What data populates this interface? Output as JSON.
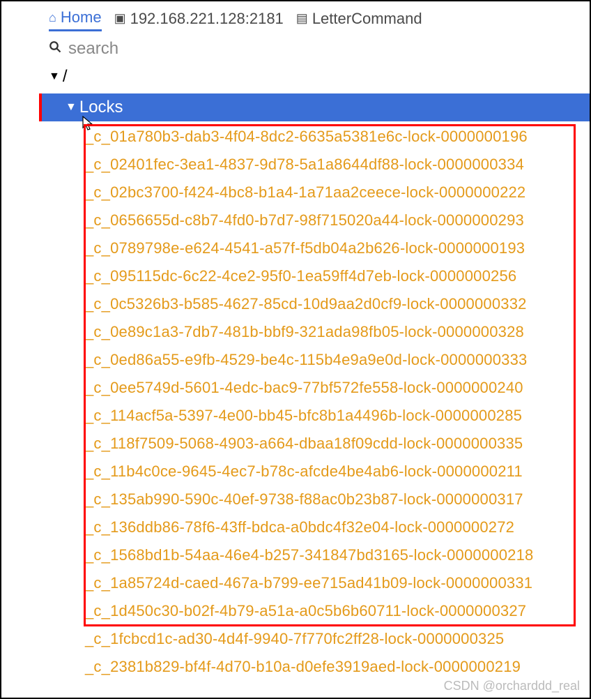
{
  "topbar": {
    "home_label": "Home",
    "server_label": "192.168.221.128:2181",
    "letter_label": "LetterCommand"
  },
  "search": {
    "placeholder": "search"
  },
  "tree": {
    "root_label": "/",
    "locks_label": "Locks",
    "nodes": [
      "_c_01a780b3-dab3-4f04-8dc2-6635a5381e6c-lock-0000000196",
      "_c_02401fec-3ea1-4837-9d78-5a1a8644df88-lock-0000000334",
      "_c_02bc3700-f424-4bc8-b1a4-1a71aa2ceece-lock-0000000222",
      "_c_0656655d-c8b7-4fd0-b7d7-98f715020a44-lock-0000000293",
      "_c_0789798e-e624-4541-a57f-f5db04a2b626-lock-0000000193",
      "_c_095115dc-6c22-4ce2-95f0-1ea59ff4d7eb-lock-0000000256",
      "_c_0c5326b3-b585-4627-85cd-10d9aa2d0cf9-lock-0000000332",
      "_c_0e89c1a3-7db7-481b-bbf9-321ada98fb05-lock-0000000328",
      "_c_0ed86a55-e9fb-4529-be4c-115b4e9a9e0d-lock-0000000333",
      "_c_0ee5749d-5601-4edc-bac9-77bf572fe558-lock-0000000240",
      "_c_114acf5a-5397-4e00-bb45-bfc8b1a4496b-lock-0000000285",
      "_c_118f7509-5068-4903-a664-dbaa18f09cdd-lock-0000000335",
      "_c_11b4c0ce-9645-4ec7-b78c-afcde4be4ab6-lock-0000000211",
      "_c_135ab990-590c-40ef-9738-f88ac0b23b87-lock-0000000317",
      "_c_136ddb86-78f6-43ff-bdca-a0bdc4f32e04-lock-0000000272",
      "_c_1568bd1b-54aa-46e4-b257-341847bd3165-lock-0000000218",
      "_c_1a85724d-caed-467a-b799-ee715ad41b09-lock-0000000331",
      "_c_1d450c30-b02f-4b79-a51a-a0c5b6b60711-lock-0000000327",
      "_c_1fcbcd1c-ad30-4d4f-9940-7f770fc2ff28-lock-0000000325",
      "_c_2381b829-bf4f-4d70-b10a-d0efe3919aed-lock-0000000219"
    ]
  },
  "watermark": "CSDN @orcharddd_real"
}
